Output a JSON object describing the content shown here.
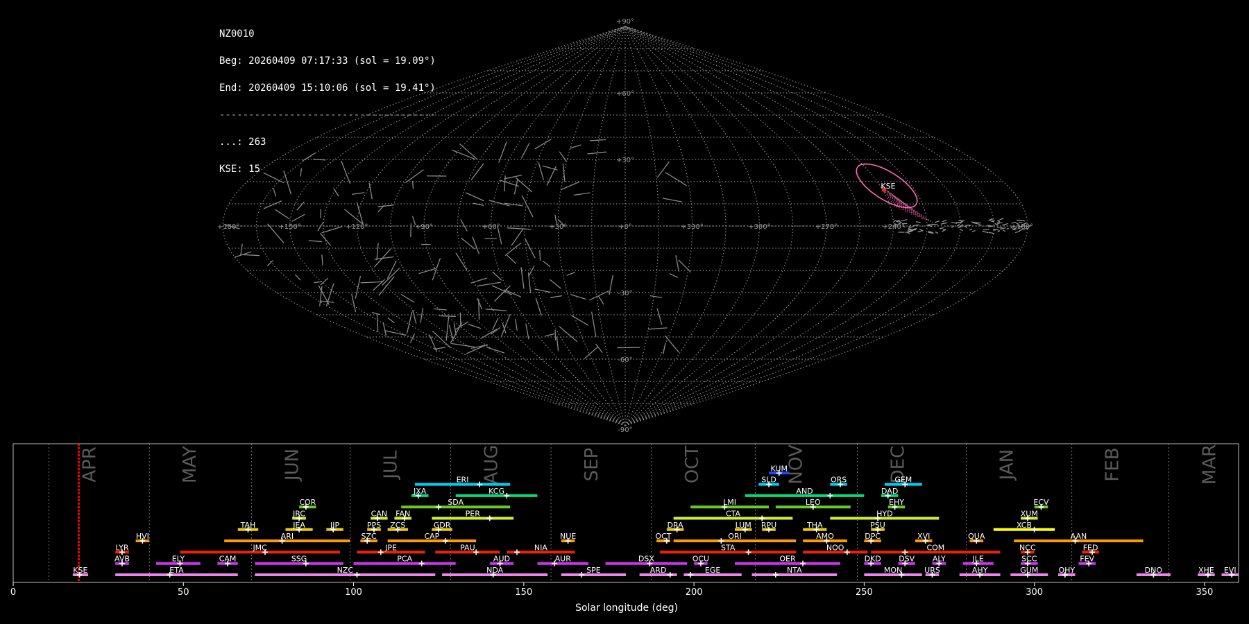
{
  "header": {
    "station": "NZ0010",
    "beg": "Beg: 20260409 07:17:33 (sol = 19.09°)",
    "end": "End: 20260409 15:10:06 (sol = 19.41°)",
    "separator": "-------------------------------------",
    "count_other": "...: 263",
    "count_kse": "KSE: 15"
  },
  "colors": {
    "background": "#000000",
    "grid": "#888888",
    "highlight": "#ff69b4",
    "current_marker": "#ff0000"
  },
  "chart_data": [
    {
      "type": "scatter",
      "projection": "sinusoidal",
      "lon_labels": [
        "+180°",
        "+150°",
        "+120°",
        "+90°",
        "+60°",
        "+30°",
        "+0°",
        "+330°",
        "+300°",
        "+270°",
        "+240°",
        "+180°"
      ],
      "lat_labels": [
        "+90°",
        "+60°",
        "+30°",
        "-30°",
        "-60°",
        "-90°"
      ],
      "highlight_shower": {
        "code": "KSE",
        "ra": 250,
        "dec": 18
      },
      "grid": true
    },
    {
      "type": "bar",
      "xlabel": "Solar longitude (deg)",
      "xlim": [
        0,
        360
      ],
      "xticks": [
        0,
        50,
        100,
        150,
        200,
        250,
        300,
        350
      ],
      "current_sol": 19.25,
      "months": [
        {
          "name": "APR",
          "start": 10.5
        },
        {
          "name": "MAY",
          "start": 40
        },
        {
          "name": "JUN",
          "start": 70
        },
        {
          "name": "JUL",
          "start": 99
        },
        {
          "name": "AUG",
          "start": 128.5
        },
        {
          "name": "SEP",
          "start": 158
        },
        {
          "name": "OCT",
          "start": 187.5
        },
        {
          "name": "NOV",
          "start": 218
        },
        {
          "name": "DEC",
          "start": 248
        },
        {
          "name": "JAN",
          "start": 280
        },
        {
          "name": "FEB",
          "start": 311
        },
        {
          "name": "MAR",
          "start": 339.5
        }
      ],
      "showers": [
        {
          "code": "KSE",
          "start": 17.5,
          "end": 22,
          "peak": 19.5,
          "row": 0,
          "color": "#ee82ee"
        },
        {
          "code": "ETA",
          "start": 30,
          "end": 66,
          "peak": 46,
          "row": 0,
          "color": "#ee82ee"
        },
        {
          "code": "NZC",
          "start": 71,
          "end": 124,
          "peak": 101,
          "row": 0,
          "color": "#ee82ee"
        },
        {
          "code": "NDA",
          "start": 126,
          "end": 157,
          "peak": 141,
          "row": 0,
          "color": "#ee82ee"
        },
        {
          "code": "SPE",
          "start": 161,
          "end": 180,
          "peak": 167,
          "row": 0,
          "color": "#ee82ee"
        },
        {
          "code": "ARD",
          "start": 184,
          "end": 195,
          "peak": 193,
          "row": 0,
          "color": "#ee82ee"
        },
        {
          "code": "EGE",
          "start": 197,
          "end": 214,
          "peak": 199,
          "row": 0,
          "color": "#ee82ee"
        },
        {
          "code": "NTA",
          "start": 217,
          "end": 242,
          "peak": 224,
          "row": 0,
          "color": "#ee82ee"
        },
        {
          "code": "MON",
          "start": 250,
          "end": 267,
          "peak": 261,
          "row": 0,
          "color": "#ee82ee"
        },
        {
          "code": "URS",
          "start": 268,
          "end": 272,
          "peak": 270,
          "row": 0,
          "color": "#ee82ee"
        },
        {
          "code": "AHY",
          "start": 278,
          "end": 290,
          "peak": 284,
          "row": 0,
          "color": "#ee82ee"
        },
        {
          "code": "GUM",
          "start": 293,
          "end": 304,
          "peak": 298,
          "row": 0,
          "color": "#ee82ee"
        },
        {
          "code": "OHY",
          "start": 307,
          "end": 312,
          "peak": 309,
          "row": 0,
          "color": "#ee82ee"
        },
        {
          "code": "DNO",
          "start": 330,
          "end": 340,
          "peak": 335,
          "row": 0,
          "color": "#ee82ee"
        },
        {
          "code": "XHE",
          "start": 348,
          "end": 353,
          "peak": 351,
          "row": 0,
          "color": "#ee82ee"
        },
        {
          "code": "EVI",
          "start": 355,
          "end": 360,
          "peak": 358,
          "row": 0,
          "color": "#ee82ee"
        },
        {
          "code": "AVB",
          "start": 30,
          "end": 34,
          "peak": 32,
          "row": 1,
          "color": "#cc33ee"
        },
        {
          "code": "ELY",
          "start": 42,
          "end": 55,
          "peak": 49,
          "row": 1,
          "color": "#cc33ee"
        },
        {
          "code": "CAM",
          "start": 60,
          "end": 66,
          "peak": 63,
          "row": 1,
          "color": "#cc33ee"
        },
        {
          "code": "SSG",
          "start": 71,
          "end": 97,
          "peak": 86,
          "row": 1,
          "color": "#cc33ee"
        },
        {
          "code": "PCA",
          "start": 100,
          "end": 130,
          "peak": 120,
          "row": 1,
          "color": "#cc33ee"
        },
        {
          "code": "AUD",
          "start": 140,
          "end": 147,
          "peak": 143,
          "row": 1,
          "color": "#cc33ee"
        },
        {
          "code": "AUR",
          "start": 154,
          "end": 169,
          "peak": 159,
          "row": 1,
          "color": "#cc33ee"
        },
        {
          "code": "DSX",
          "start": 174,
          "end": 198,
          "peak": 187,
          "row": 1,
          "color": "#cc33ee"
        },
        {
          "code": "OCU",
          "start": 200,
          "end": 204,
          "peak": 202,
          "row": 1,
          "color": "#cc33ee"
        },
        {
          "code": "OER",
          "start": 212,
          "end": 243,
          "peak": 232,
          "row": 1,
          "color": "#cc33ee"
        },
        {
          "code": "DKD",
          "start": 250,
          "end": 255,
          "peak": 252,
          "row": 1,
          "color": "#cc33ee"
        },
        {
          "code": "DSV",
          "start": 260,
          "end": 265,
          "peak": 262,
          "row": 1,
          "color": "#cc33ee"
        },
        {
          "code": "ALY",
          "start": 270,
          "end": 274,
          "peak": 272,
          "row": 1,
          "color": "#cc33ee"
        },
        {
          "code": "JLE",
          "start": 279,
          "end": 288,
          "peak": 283,
          "row": 1,
          "color": "#cc33ee"
        },
        {
          "code": "SCC",
          "start": 296,
          "end": 301,
          "peak": 298,
          "row": 1,
          "color": "#cc33ee"
        },
        {
          "code": "FEV",
          "start": 313,
          "end": 318,
          "peak": 316,
          "row": 1,
          "color": "#cc33ee"
        },
        {
          "code": "LYR",
          "start": 30,
          "end": 34,
          "peak": 32,
          "row": 2,
          "color": "#ee2200"
        },
        {
          "code": "JMC",
          "start": 49,
          "end": 96,
          "peak": 74,
          "row": 2,
          "color": "#ee2200"
        },
        {
          "code": "JPE",
          "start": 101,
          "end": 121,
          "peak": 108,
          "row": 2,
          "color": "#ee2200"
        },
        {
          "code": "PAU",
          "start": 124,
          "end": 143,
          "peak": 136,
          "row": 2,
          "color": "#ee2200"
        },
        {
          "code": "NIA",
          "start": 145,
          "end": 165,
          "peak": 148,
          "row": 2,
          "color": "#ee2200"
        },
        {
          "code": "STA",
          "start": 190,
          "end": 230,
          "peak": 216,
          "row": 2,
          "color": "#ee2200"
        },
        {
          "code": "NOO",
          "start": 232,
          "end": 251,
          "peak": 245,
          "row": 2,
          "color": "#ee2200"
        },
        {
          "code": "COM",
          "start": 252,
          "end": 290,
          "peak": 262,
          "row": 2,
          "color": "#ee2200"
        },
        {
          "code": "NCC",
          "start": 296,
          "end": 300,
          "peak": 298,
          "row": 2,
          "color": "#ee2200"
        },
        {
          "code": "FED",
          "start": 314,
          "end": 319,
          "peak": 317,
          "row": 2,
          "color": "#ee2200"
        },
        {
          "code": "HVI",
          "start": 36,
          "end": 40,
          "peak": 38,
          "row": 3,
          "color": "#ff9900"
        },
        {
          "code": "ARI",
          "start": 62,
          "end": 99,
          "peak": 79,
          "row": 3,
          "color": "#ff9900"
        },
        {
          "code": "SZC",
          "start": 102,
          "end": 107,
          "peak": 104,
          "row": 3,
          "color": "#ff9900"
        },
        {
          "code": "CAP",
          "start": 110,
          "end": 136,
          "peak": 127,
          "row": 3,
          "color": "#ff9900"
        },
        {
          "code": "NUE",
          "start": 161,
          "end": 165,
          "peak": 163,
          "row": 3,
          "color": "#ff9900"
        },
        {
          "code": "OCT",
          "start": 189,
          "end": 193,
          "peak": 192,
          "row": 3,
          "color": "#ff9900"
        },
        {
          "code": "ORI",
          "start": 194,
          "end": 230,
          "peak": 208,
          "row": 3,
          "color": "#ff9900"
        },
        {
          "code": "AMO",
          "start": 232,
          "end": 245,
          "peak": 239,
          "row": 3,
          "color": "#ff9900"
        },
        {
          "code": "DPC",
          "start": 250,
          "end": 255,
          "peak": 252,
          "row": 3,
          "color": "#ff9900"
        },
        {
          "code": "XVI",
          "start": 265,
          "end": 270,
          "peak": 268,
          "row": 3,
          "color": "#ff9900"
        },
        {
          "code": "QUA",
          "start": 281,
          "end": 285,
          "peak": 283,
          "row": 3,
          "color": "#ff9900"
        },
        {
          "code": "AAN",
          "start": 294,
          "end": 332,
          "peak": 312,
          "row": 3,
          "color": "#ff9900"
        },
        {
          "code": "TAH",
          "start": 66,
          "end": 72,
          "peak": 69,
          "row": 4,
          "color": "#eecc00"
        },
        {
          "code": "JEA",
          "start": 80,
          "end": 88,
          "peak": 84,
          "row": 4,
          "color": "#eecc00"
        },
        {
          "code": "JIP",
          "start": 92,
          "end": 97,
          "peak": 94,
          "row": 4,
          "color": "#eecc00"
        },
        {
          "code": "PPS",
          "start": 104,
          "end": 108,
          "peak": 106,
          "row": 4,
          "color": "#eecc00"
        },
        {
          "code": "ZCS",
          "start": 110,
          "end": 116,
          "peak": 113,
          "row": 4,
          "color": "#eecc00"
        },
        {
          "code": "GDR",
          "start": 123,
          "end": 129,
          "peak": 125,
          "row": 4,
          "color": "#eecc00"
        },
        {
          "code": "DRA",
          "start": 192,
          "end": 197,
          "peak": 195,
          "row": 4,
          "color": "#eecc00"
        },
        {
          "code": "LUM",
          "start": 212,
          "end": 217,
          "peak": 215,
          "row": 4,
          "color": "#eecc00"
        },
        {
          "code": "RPU",
          "start": 220,
          "end": 224,
          "peak": 222,
          "row": 4,
          "color": "#eecc00"
        },
        {
          "code": "THA",
          "start": 232,
          "end": 239,
          "peak": 236,
          "row": 4,
          "color": "#eecc00"
        },
        {
          "code": "PSU",
          "start": 252,
          "end": 256,
          "peak": 254,
          "row": 4,
          "color": "#eecc00"
        },
        {
          "code": "XCB",
          "start": 288,
          "end": 306,
          "peak": 300,
          "row": 4,
          "color": "#ffff00"
        },
        {
          "code": "JRC",
          "start": 82,
          "end": 86,
          "peak": 84,
          "row": 5,
          "color": "#ccee33"
        },
        {
          "code": "CAN",
          "start": 105,
          "end": 110,
          "peak": 107,
          "row": 5,
          "color": "#ccee33"
        },
        {
          "code": "FAN",
          "start": 112,
          "end": 117,
          "peak": 115,
          "row": 5,
          "color": "#ccee33"
        },
        {
          "code": "PER",
          "start": 123,
          "end": 147,
          "peak": 140,
          "row": 5,
          "color": "#ccee33"
        },
        {
          "code": "CTA",
          "start": 194,
          "end": 229,
          "peak": 220,
          "row": 5,
          "color": "#ccee33"
        },
        {
          "code": "HYD",
          "start": 240,
          "end": 272,
          "peak": 254,
          "row": 5,
          "color": "#ccee33"
        },
        {
          "code": "XUM",
          "start": 296,
          "end": 301,
          "peak": 298,
          "row": 5,
          "color": "#ccee33"
        },
        {
          "code": "COR",
          "start": 84,
          "end": 89,
          "peak": 86,
          "row": 6,
          "color": "#66cc22"
        },
        {
          "code": "SDA",
          "start": 114,
          "end": 146,
          "peak": 125,
          "row": 6,
          "color": "#66cc22"
        },
        {
          "code": "LMI",
          "start": 199,
          "end": 222,
          "peak": 209,
          "row": 6,
          "color": "#66cc22"
        },
        {
          "code": "LEO",
          "start": 224,
          "end": 246,
          "peak": 235,
          "row": 6,
          "color": "#66cc22"
        },
        {
          "code": "EHY",
          "start": 257,
          "end": 262,
          "peak": 259,
          "row": 6,
          "color": "#66cc22"
        },
        {
          "code": "ECV",
          "start": 300,
          "end": 304,
          "peak": 302,
          "row": 6,
          "color": "#66cc22"
        },
        {
          "code": "JXA",
          "start": 117,
          "end": 122,
          "peak": 119,
          "row": 7,
          "color": "#00dd77"
        },
        {
          "code": "KCG",
          "start": 130,
          "end": 154,
          "peak": 145,
          "row": 7,
          "color": "#00dd77"
        },
        {
          "code": "AND",
          "start": 215,
          "end": 250,
          "peak": 240,
          "row": 7,
          "color": "#00dd77"
        },
        {
          "code": "DAD",
          "start": 255,
          "end": 260,
          "peak": 257,
          "row": 7,
          "color": "#00dd77"
        },
        {
          "code": "ERI",
          "start": 118,
          "end": 146,
          "peak": 137,
          "row": 8,
          "color": "#00ccee"
        },
        {
          "code": "SLD",
          "start": 219,
          "end": 225,
          "peak": 222,
          "row": 8,
          "color": "#00ccee"
        },
        {
          "code": "ORS",
          "start": 240,
          "end": 245,
          "peak": 243,
          "row": 8,
          "color": "#00ccee"
        },
        {
          "code": "GEM",
          "start": 256,
          "end": 267,
          "peak": 262,
          "row": 8,
          "color": "#00ccee"
        },
        {
          "code": "KUM",
          "start": 222,
          "end": 228,
          "peak": 225,
          "row": 9,
          "color": "#2244ff"
        }
      ]
    }
  ]
}
